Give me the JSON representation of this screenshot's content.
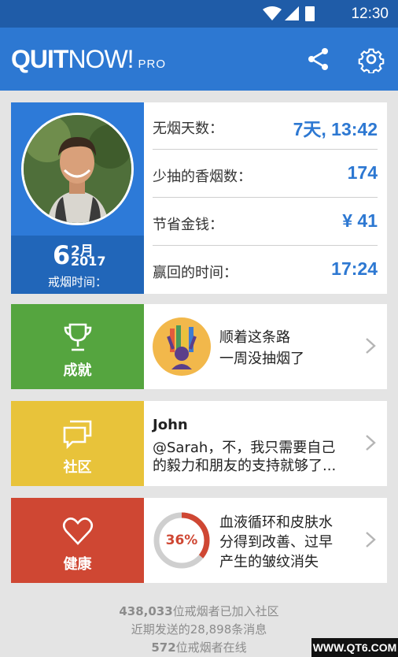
{
  "status_bar": {
    "time": "12:30"
  },
  "app_bar": {
    "brand_quit": "QUIT",
    "brand_now": "NOW!",
    "brand_pro": "PRO"
  },
  "profile": {
    "date_day": "6",
    "date_month": "2月",
    "date_year": "2017",
    "date_label": "戒烟时间："
  },
  "stats": [
    {
      "label": "无烟天数：",
      "value": "7天, 13:42"
    },
    {
      "label": "少抽的香烟数：",
      "value": "174"
    },
    {
      "label": "节省金钱：",
      "value": "¥ 41"
    },
    {
      "label": "赢回的时间：",
      "value": "17:24"
    }
  ],
  "achievements": {
    "label": "成就",
    "title": "顺着这条路",
    "subtitle": "一周没抽烟了"
  },
  "community": {
    "label": "社区",
    "author": "John",
    "message": "@Sarah，不，我只需要自己\n的毅力和朋友的支持就够了..."
  },
  "health": {
    "label": "健康",
    "percent": 36,
    "percent_label": "36%",
    "text": "血液循环和皮肤水\n分得到改善、过早\n产生的皱纹消失"
  },
  "footer": {
    "line1_num": "438,033",
    "line1_text": "位戒烟者已加入社区",
    "line2_pre": "近期发送的",
    "line2_num": "28,898",
    "line2_text": "条消息",
    "line3_num": "572",
    "line3_text": "位戒烟者在线"
  },
  "watermark": "WWW.QT6.COM",
  "colors": {
    "primary": "#2d78d2",
    "achievements": "#55a53f",
    "community": "#e8c33a",
    "health": "#cf4733"
  }
}
